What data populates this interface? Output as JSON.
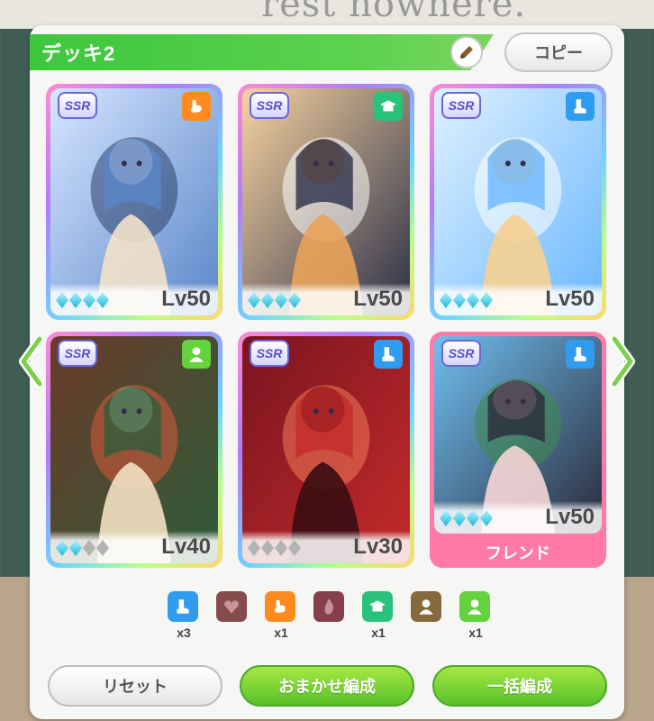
{
  "background": {
    "text": "rest nowhere."
  },
  "header": {
    "title": "デッキ2",
    "copy_label": "コピー"
  },
  "cards": [
    {
      "rarity": "SSR",
      "type": "power",
      "type_color": "#ff8a1f",
      "level": "Lv50",
      "gems": [
        1,
        1,
        1,
        1
      ],
      "friend": false,
      "palette": [
        "#d6e6ff",
        "#5a86c9",
        "#f2e1c9",
        "#2c3f6a"
      ]
    },
    {
      "rarity": "SSR",
      "type": "wisdom",
      "type_color": "#29c27a",
      "level": "Lv50",
      "gems": [
        1,
        1,
        1,
        1
      ],
      "friend": false,
      "palette": [
        "#f7d3a0",
        "#2b2f48",
        "#e8a35a",
        "#ffffff"
      ]
    },
    {
      "rarity": "SSR",
      "type": "speed",
      "type_color": "#2f9cf0",
      "level": "Lv50",
      "gems": [
        1,
        1,
        1,
        1
      ],
      "friend": false,
      "palette": [
        "#dff1ff",
        "#6bb7ff",
        "#f7d08f",
        "#ffffff"
      ]
    },
    {
      "rarity": "SSR",
      "type": "friend",
      "type_color": "#63d23c",
      "level": "Lv40",
      "gems": [
        1,
        1,
        0,
        0
      ],
      "friend": false,
      "palette": [
        "#6b3a2a",
        "#2e5d3a",
        "#f3e0c2",
        "#d85a3c"
      ]
    },
    {
      "rarity": "SSR",
      "type": "speed",
      "type_color": "#2f9cf0",
      "level": "Lv30",
      "gems": [
        0,
        0,
        0,
        0
      ],
      "friend": false,
      "palette": [
        "#7a1420",
        "#c42b2b",
        "#3a0c12",
        "#f07a5a"
      ]
    },
    {
      "rarity": "SSR",
      "type": "speed",
      "type_color": "#2f9cf0",
      "level": "Lv50",
      "gems": [
        1,
        1,
        1,
        1
      ],
      "friend": true,
      "friend_label": "フレンド",
      "palette": [
        "#6fbff0",
        "#2a2a3a",
        "#f6d6d6",
        "#3e8a4a"
      ]
    }
  ],
  "summary": [
    {
      "icon": "speed-icon",
      "color": "#2f9cf0",
      "count": "x3",
      "dim": false
    },
    {
      "icon": "heart-icon",
      "color": "#7a3a3a",
      "count": "",
      "dim": true
    },
    {
      "icon": "power-icon",
      "color": "#ff8a1f",
      "count": "x1",
      "dim": false
    },
    {
      "icon": "guts-icon",
      "color": "#7a2d3a",
      "count": "",
      "dim": true
    },
    {
      "icon": "wisdom-icon",
      "color": "#29c27a",
      "count": "x1",
      "dim": false
    },
    {
      "icon": "friend-icon-dim",
      "color": "#7a5a2a",
      "count": "",
      "dim": true
    },
    {
      "icon": "friend-icon",
      "color": "#63d23c",
      "count": "x1",
      "dim": false
    }
  ],
  "buttons": {
    "reset": "リセット",
    "auto": "おまかせ編成",
    "bulk": "一括編成"
  }
}
